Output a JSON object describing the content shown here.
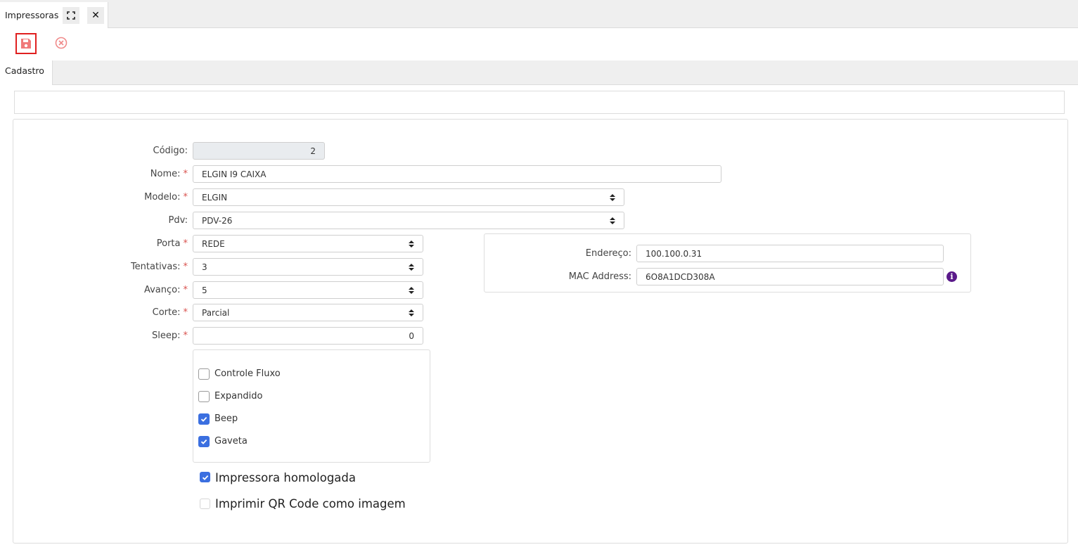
{
  "window_tab": {
    "title": "Impressoras",
    "expand_icon": "expand-icon",
    "close_icon": "close-icon"
  },
  "toolbar": {
    "save_icon": "floppy-disk-icon",
    "cancel_icon": "cancel-circle-icon"
  },
  "section_tab": {
    "label": "Cadastro"
  },
  "form": {
    "codigo": {
      "label": "Código:",
      "value": "2"
    },
    "nome": {
      "label": "Nome:",
      "required": "*",
      "value": "ELGIN I9 CAIXA"
    },
    "modelo": {
      "label": "Modelo:",
      "required": "*",
      "value": "ELGIN"
    },
    "pdv": {
      "label": "Pdv:",
      "value": "PDV-26"
    },
    "porta": {
      "label": "Porta",
      "required": "*",
      "value": "REDE"
    },
    "tentativas": {
      "label": "Tentativas:",
      "required": "*",
      "value": "3"
    },
    "avanco": {
      "label": "Avanço:",
      "required": "*",
      "value": "5"
    },
    "corte": {
      "label": "Corte:",
      "required": "*",
      "value": "Parcial"
    },
    "sleep": {
      "label": "Sleep:",
      "required": "*",
      "value": "0"
    }
  },
  "network": {
    "endereco": {
      "label": "Endereço:",
      "value": "100.100.0.31"
    },
    "mac": {
      "label": "MAC Address:",
      "value": "6O8A1DCD308A",
      "info_icon": "info-icon"
    }
  },
  "options": [
    {
      "label": "Controle Fluxo",
      "checked": false
    },
    {
      "label": "Expandido",
      "checked": false
    },
    {
      "label": "Beep",
      "checked": true
    },
    {
      "label": "Gaveta",
      "checked": true
    }
  ],
  "extra": {
    "homologada": {
      "label": "Impressora homologada",
      "checked": true
    },
    "qr_imagem": {
      "label": "Imprimir QR Code como imagem",
      "checked": false
    }
  },
  "colors": {
    "accent": "#3b6fe0",
    "required": "#d9534f",
    "save_border": "#e02020",
    "info": "#5a1a8a"
  }
}
